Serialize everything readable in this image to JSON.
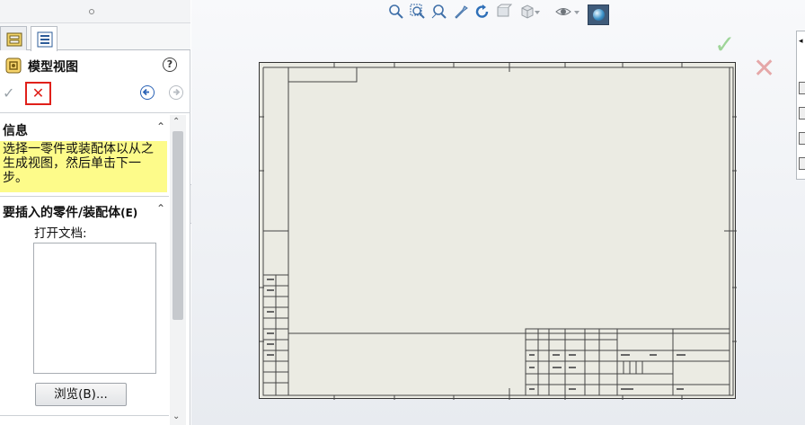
{
  "left_panel": {
    "title": "模型视图",
    "help_glyph": "?",
    "ok_glyph": "✓",
    "cancel_glyph": "✕",
    "sections": {
      "info": {
        "title": "信息",
        "message": "选择一零件或装配体以从之生成视图，然后单击下一步。"
      },
      "insert": {
        "title": "要插入的零件/装配体",
        "shortcut": "(E)",
        "open_docs_label": "打开文档:",
        "open_docs": [],
        "browse_label": "浏览(B)..."
      }
    },
    "chevron_up": "⌃",
    "chevron_down": "⌄"
  },
  "graphics": {
    "hud_icons": [
      "zoom-to-fit-icon",
      "zoom-to-area-icon",
      "zoom-selected-icon",
      "pan-icon",
      "rotate-icon",
      "view-orientation-icon",
      "display-style-icon",
      "hide-show-icon",
      "apply-scene-icon"
    ],
    "colors": {
      "confirm_ok": "#8fd088",
      "confirm_cancel": "#e39a9a",
      "sheet": "#ebebe3",
      "info_highlight": "#fdfb8a",
      "cancel_outline": "#e0201a"
    }
  }
}
